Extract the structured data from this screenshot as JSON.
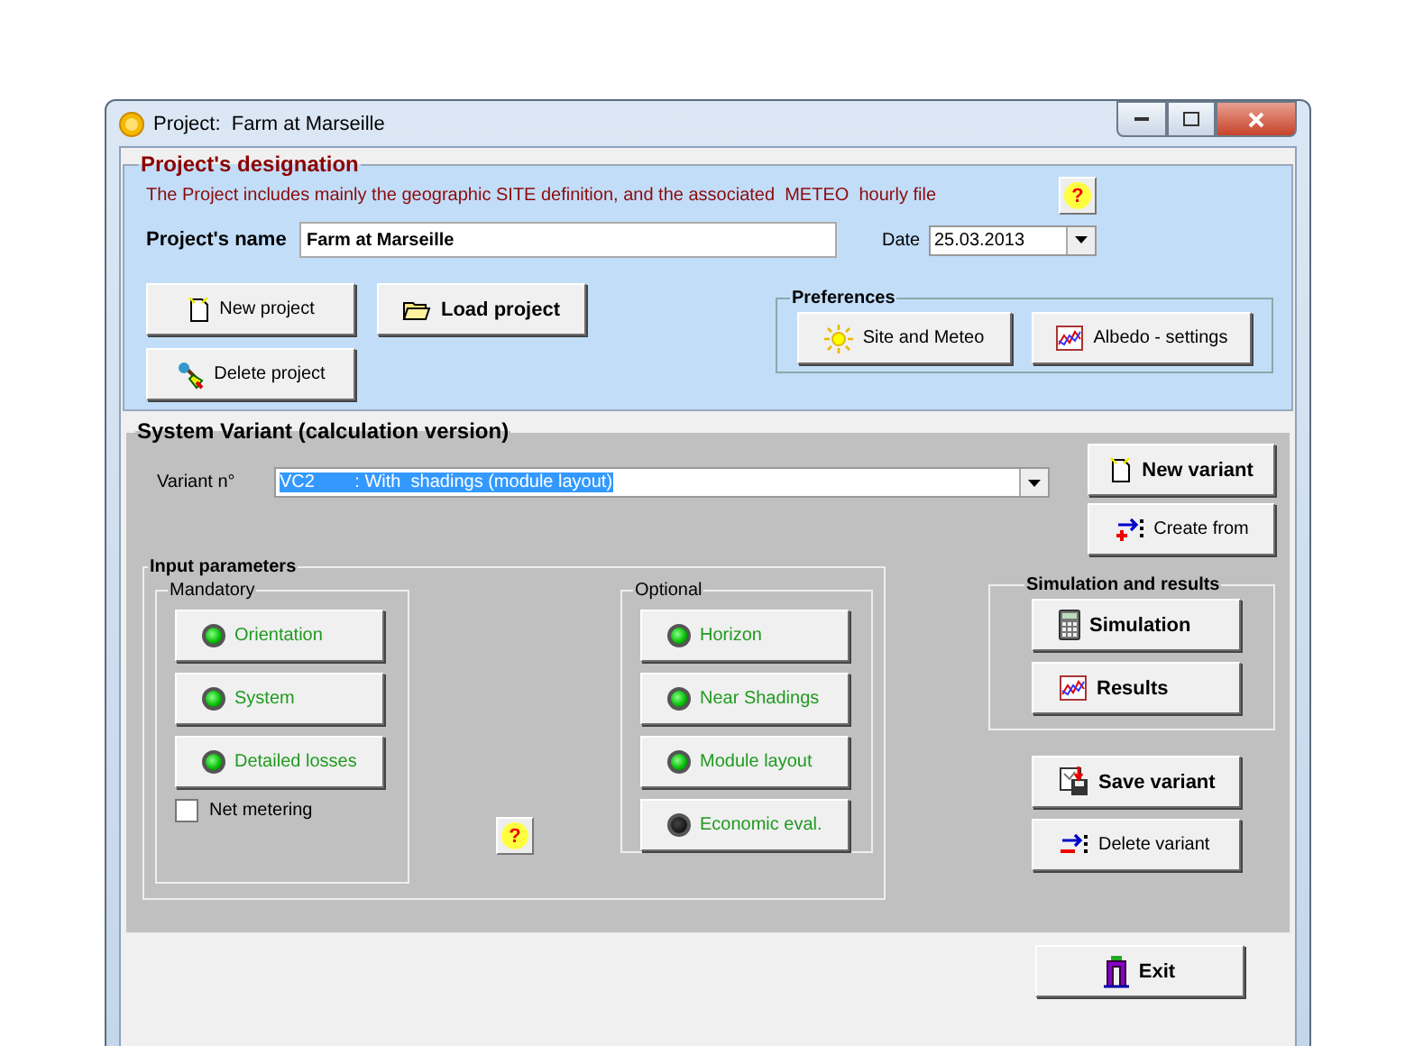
{
  "window": {
    "title": "Project:  Farm at Marseille"
  },
  "designation": {
    "legend": "Project's designation",
    "info": "The Project includes mainly the geographic SITE definition, and the associated  METEO  hourly file",
    "help": "?",
    "name_label": "Project's name",
    "name_value": "Farm at Marseille",
    "date_label": "Date",
    "date_value": "25.03.2013",
    "new_project": "New project",
    "load_project": "Load project",
    "delete_project": "Delete project",
    "preferences": {
      "legend": "Preferences",
      "site_meteo": "Site and Meteo",
      "albedo": "Albedo - settings"
    }
  },
  "variant": {
    "legend": "System Variant (calculation version)",
    "label": "Variant n°",
    "value": "VC2        : With  shadings (module layout)",
    "value_selected": true,
    "new_variant": "New variant",
    "create_from": "Create from",
    "input": {
      "legend": "Input parameters",
      "help": "?",
      "mandatory": {
        "legend": "Mandatory",
        "items": [
          {
            "label": "Orientation",
            "lit": true
          },
          {
            "label": "System",
            "lit": true
          },
          {
            "label": "Detailed losses",
            "lit": true
          }
        ],
        "net_metering": {
          "label": "Net metering",
          "checked": false
        }
      },
      "optional": {
        "legend": "Optional",
        "items": [
          {
            "label": "Horizon",
            "lit": true
          },
          {
            "label": "Near Shadings",
            "lit": true
          },
          {
            "label": "Module layout",
            "lit": true
          },
          {
            "label": "Economic eval.",
            "lit": false
          }
        ]
      }
    },
    "simulation": {
      "legend": "Simulation and results",
      "simulation": "Simulation",
      "results": "Results"
    },
    "save_variant": "Save variant",
    "delete_variant": "Delete variant"
  },
  "exit": "Exit"
}
